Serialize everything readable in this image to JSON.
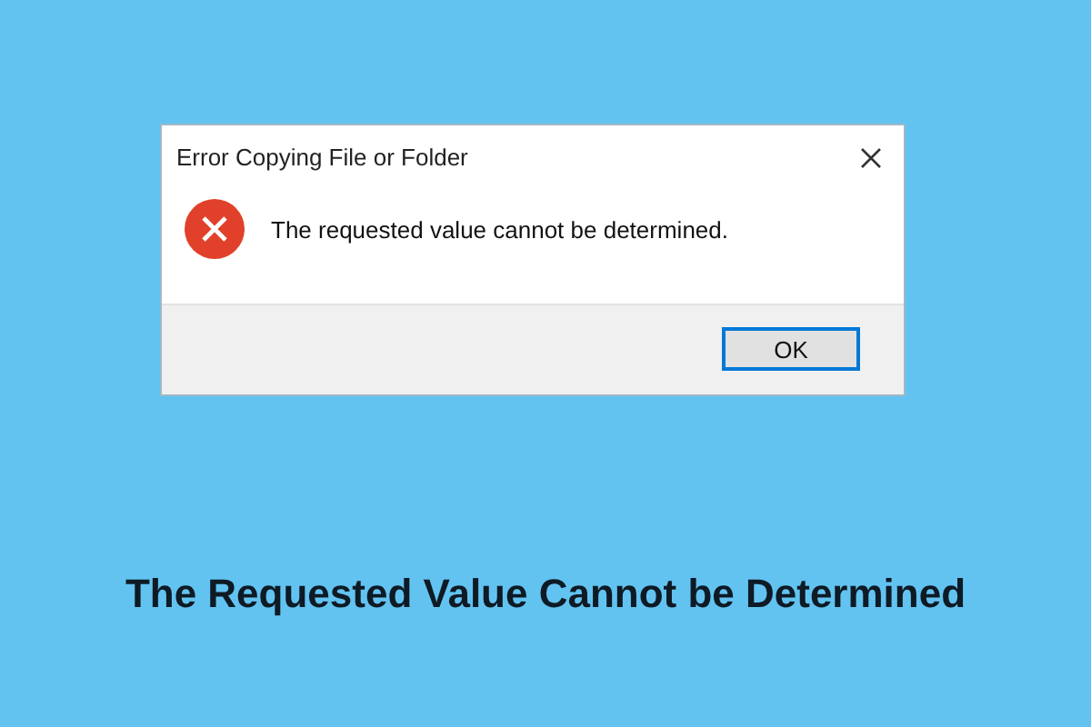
{
  "dialog": {
    "title": "Error Copying File or Folder",
    "message": "The requested value cannot be determined.",
    "buttons": [
      {
        "label": "OK",
        "kind": "default"
      }
    ]
  },
  "headline": "The Requested Value Cannot be Determined"
}
